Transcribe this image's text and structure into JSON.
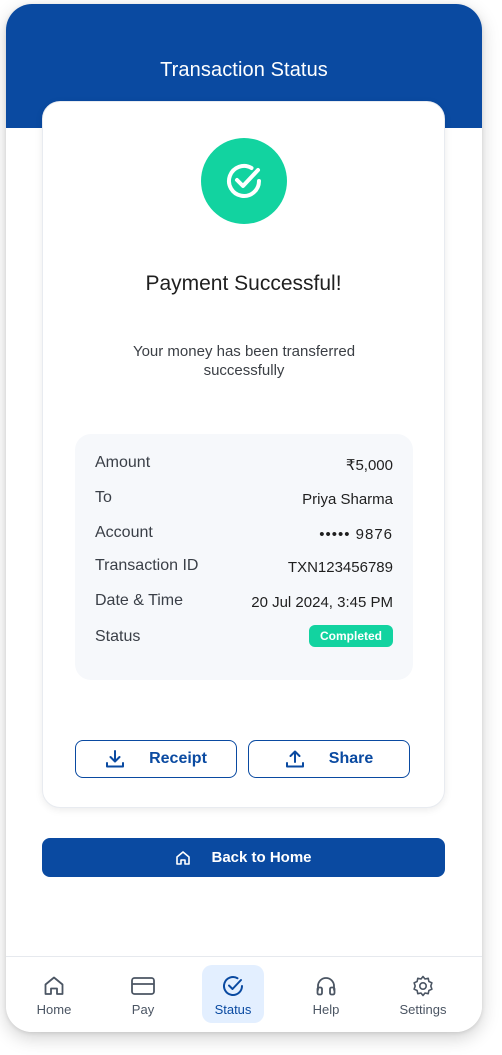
{
  "header": {
    "title": "Transaction Status"
  },
  "result": {
    "title": "Payment Successful!",
    "subtitle": "Your money has been transferred successfully"
  },
  "details": {
    "rows": [
      {
        "label": "Amount",
        "value": "₹5,000"
      },
      {
        "label": "To",
        "value": "Priya Sharma"
      },
      {
        "label": "Account",
        "value": "••••• 9876"
      },
      {
        "label": "Transaction ID",
        "value": "TXN123456789"
      },
      {
        "label": "Date & Time",
        "value": "20 Jul 2024, 3:45 PM"
      },
      {
        "label": "Status",
        "value": "Completed"
      }
    ]
  },
  "actions": {
    "receipt_label": "Receipt",
    "share_label": "Share"
  },
  "home_button": {
    "label": "Back to Home"
  },
  "nav": {
    "items": [
      {
        "label": "Home",
        "icon": "home-icon"
      },
      {
        "label": "Pay",
        "icon": "card-icon"
      },
      {
        "label": "Status",
        "icon": "check-circle-icon",
        "active": true
      },
      {
        "label": "Help",
        "icon": "headphones-icon"
      },
      {
        "label": "Settings",
        "icon": "gear-icon"
      }
    ]
  },
  "colors": {
    "primary": "#0a4aa1",
    "success": "#12d3a0",
    "active_bg": "#e3efff"
  }
}
